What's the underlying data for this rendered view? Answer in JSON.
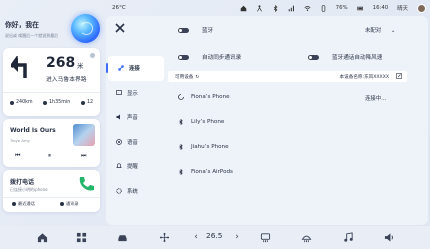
{
  "status_bar": {
    "cabin_temp": "26°C",
    "battery": "76%",
    "time": "16:40",
    "weather": "晴天"
  },
  "left": {
    "greeting": "你好，我在",
    "greeting_sub": "说出或 唤醒后一个就说到最后",
    "nav": {
      "distance": "268",
      "unit": "米",
      "road": "进入马鲁本界路",
      "remaining_km": "240km",
      "remaining_time": "1h35min",
      "count": "12"
    },
    "music": {
      "title": "World Is Ours",
      "artist": "Troye Amy",
      "prev": "⏮",
      "pause": "⏸",
      "next": "⏭"
    },
    "call": {
      "title": "拨打电话",
      "subtitle": "已连接小明的iphone",
      "recent": "最近通话",
      "contacts": "通讯录"
    }
  },
  "settings": {
    "menu": [
      {
        "label": "连接",
        "icon": "link-icon",
        "active": true
      },
      {
        "label": "显示",
        "icon": "display-icon",
        "active": false
      },
      {
        "label": "声音",
        "icon": "sound-icon",
        "active": false
      },
      {
        "label": "语音",
        "icon": "voice-icon",
        "active": false
      },
      {
        "label": "提醒",
        "icon": "bell-icon",
        "active": false
      },
      {
        "label": "系统",
        "icon": "system-icon",
        "active": false
      }
    ],
    "bluetooth_label": "蓝牙",
    "pair_label": "未配对",
    "sync_label": "自动同步通讯录",
    "cooling_label": "蓝牙通话自动降风速",
    "available_label": "可用设备",
    "device_name_label": "本设备名称:东风XXXXX",
    "devices": [
      {
        "name": "Fiona’s Phone",
        "icon": "loading-icon",
        "status": "连接中…"
      },
      {
        "name": "Lily’s Phone",
        "icon": "bluetooth-icon"
      },
      {
        "name": "Jiahu’s Phone",
        "icon": "bluetooth-icon"
      },
      {
        "name": "Fiona’s AirPods",
        "icon": "bluetooth-icon"
      }
    ]
  },
  "dock": {
    "temperature": "26.5",
    "left_arrow": "‹",
    "right_arrow": "›"
  },
  "colors": {
    "accent": "#3f6df5",
    "text": "#2a3346",
    "panel": "#eef2f9"
  }
}
